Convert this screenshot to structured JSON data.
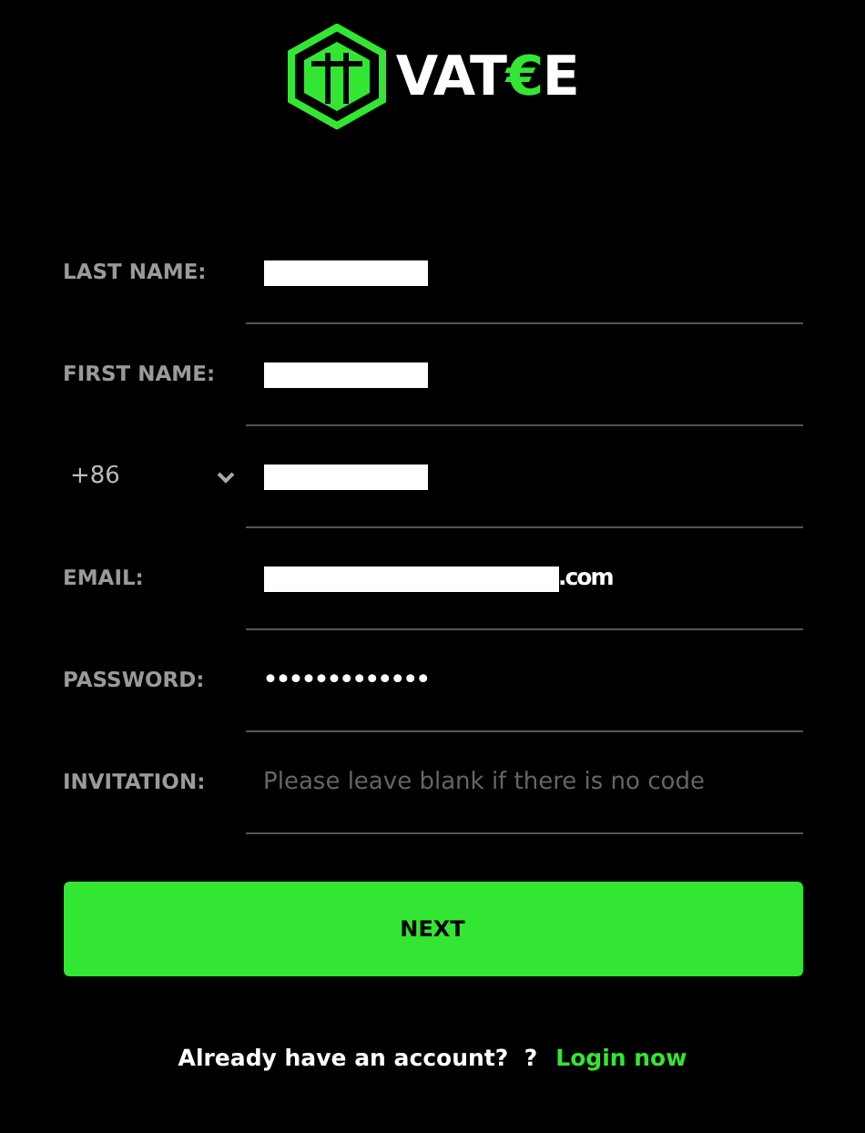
{
  "logo": {
    "parts": [
      {
        "text": "VAT",
        "color": "#ffffff"
      },
      {
        "text": "€",
        "color": "#33e633"
      },
      {
        "text": "E",
        "color": "#ffffff"
      }
    ]
  },
  "fields": [
    {
      "kind": "text",
      "label": "LAST NAME:",
      "redacted": true
    },
    {
      "kind": "text",
      "label": "FIRST NAME:",
      "redacted": true
    },
    {
      "kind": "phone",
      "country_code": "+86",
      "redacted": true
    },
    {
      "kind": "text",
      "label": "EMAIL:",
      "redacted": true,
      "value": ".com"
    },
    {
      "kind": "text",
      "label": "PASSWORD:",
      "redacted": false,
      "value": "•••••••••••••"
    },
    {
      "kind": "text",
      "label": "INVITATION:",
      "redacted": false,
      "placeholder": "Please leave blank if there is no code"
    }
  ],
  "next_button": "NEXT",
  "footer": {
    "prompt": "Already have an account?  ?",
    "link": "Login now"
  }
}
